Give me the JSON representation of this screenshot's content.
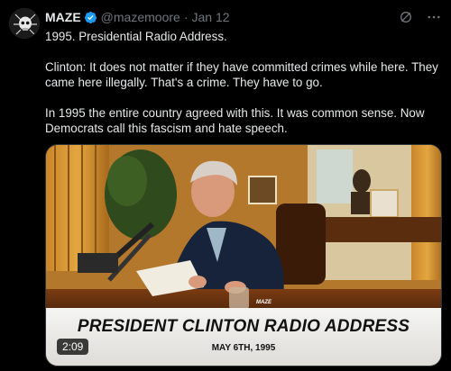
{
  "author": {
    "name": "MAZE",
    "handle": "@mazemoore",
    "separator": "·",
    "date": "Jan 12"
  },
  "tweet": {
    "line1": "1995. Presidential Radio Address.",
    "line2": "Clinton: It does not matter if they have committed crimes while here. They came here illegally. That's a crime. They have to go.",
    "line3": "In 1995 the entire country agreed with this. It was common sense. Now Democrats call this fascism and hate speech."
  },
  "media": {
    "caption_title": "PRESIDENT CLINTON RADIO ADDRESS",
    "caption_date": "MAY 6TH, 1995",
    "duration": "2:09",
    "watermark": "MAZE"
  },
  "colors": {
    "verified": "#1d9bf0",
    "muted": "#71767b",
    "text": "#e7e9ea",
    "background": "#000000"
  },
  "icons": {
    "verified": "verified-badge-icon",
    "grok": "grok-icon",
    "more": "more-icon"
  }
}
